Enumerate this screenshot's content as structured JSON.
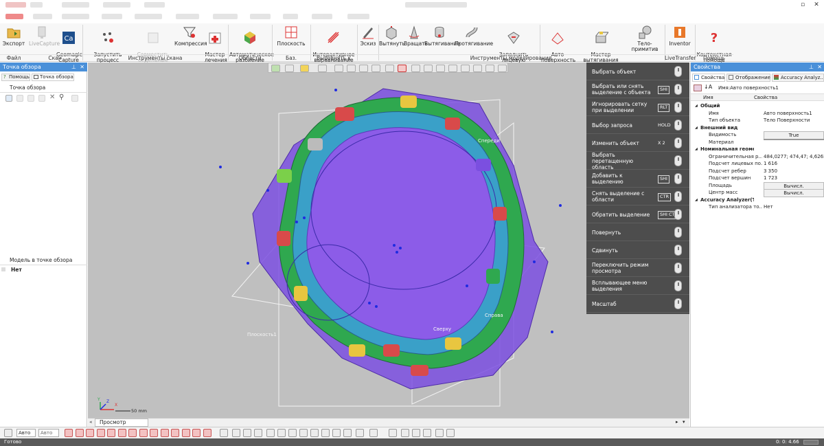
{
  "colors": {
    "accent": "#4a90d9",
    "menu_bg": "#4d4d4d",
    "mesh_purple": "#7b4fe0",
    "mesh_green": "#2fa84f",
    "material_swatch": "#e8e07a"
  },
  "window": {
    "restore_icon": "restore-icon",
    "close_icon": "close-icon"
  },
  "ribbon": {
    "buttons": [
      {
        "label": "Экспорт",
        "icon": "folder-icon",
        "disabled": false
      },
      {
        "label": "LiveCapture",
        "icon": "livecapture-icon",
        "disabled": true
      },
      {
        "label": "Geomagic\nCapture",
        "icon": "capture-icon",
        "disabled": false
      },
      {
        "label": "Запустить процесс\nсканирования",
        "icon": "scan-process-icon",
        "disabled": false
      },
      {
        "label": "Совместить\nотдельные сканы",
        "icon": "align-scans-icon",
        "disabled": true
      },
      {
        "label": "Компрессия",
        "icon": "compress-icon",
        "disabled": false
      },
      {
        "label": "Мастер\nлечения",
        "icon": "healing-icon",
        "disabled": false
      },
      {
        "label": "Автоматическое\nразбиение",
        "icon": "auto-segment-icon",
        "disabled": false
      },
      {
        "label": "Плоскость",
        "icon": "plane-icon",
        "disabled": false
      },
      {
        "label": "Интерактивное\nвыравнивание",
        "icon": "interactive-align-icon",
        "disabled": false
      },
      {
        "label": "Эскиз",
        "icon": "sketch-icon",
        "disabled": false
      },
      {
        "label": "Вытянуть",
        "icon": "extrude-icon",
        "disabled": false
      },
      {
        "label": "Вращать",
        "icon": "revolve-icon",
        "disabled": false
      },
      {
        "label": "Вытягивание",
        "icon": "sweep-icon",
        "disabled": false
      },
      {
        "label": "Протягивание",
        "icon": "loft-icon",
        "disabled": false
      },
      {
        "label": "Заполнить лицевую\nповерхность",
        "icon": "fill-face-icon",
        "disabled": false
      },
      {
        "label": "Авто\nповерхность",
        "icon": "auto-surface-icon",
        "disabled": false
      },
      {
        "label": "Мастер вытягивания\nпо сечениям",
        "icon": "mesh-fit-icon",
        "disabled": false
      },
      {
        "label": "Тело-примитив",
        "icon": "primitive-icon",
        "disabled": false
      },
      {
        "label": "Inventor",
        "icon": "inventor-icon",
        "disabled": false
      },
      {
        "label": "Контекстная\nпомощь",
        "icon": "help-icon",
        "disabled": false
      }
    ],
    "groups": [
      "Файл",
      "Скан",
      "Инструменты скана",
      "Области",
      "Баз. геометрия",
      "Выровнять к миру",
      "Инструменты моделирования",
      "LiveTransfer",
      "Помощь"
    ]
  },
  "left_panel": {
    "header": "Точка обзора",
    "tabs": [
      "Помощь",
      "Точка обзора"
    ],
    "section_title": "Точка обзора",
    "model_label": "Модель в точке обзора",
    "model_value": "Нет"
  },
  "viewport": {
    "labels": {
      "front": "Спереди",
      "right": "Справа",
      "top": "Сверху",
      "plane": "Плоскость1"
    },
    "scale_text": "50 mm",
    "axes": {
      "x": "X",
      "y": "Y",
      "z": "Z"
    }
  },
  "mouse_menu": [
    {
      "label": "Выбрать объект",
      "key": ""
    },
    {
      "label": "Выбрать или снять выделение с объекта",
      "key": "SHI"
    },
    {
      "label": "Игнорировать сетку при выделении",
      "key": "RLT"
    },
    {
      "label": "Выбор запроса",
      "key": "HOLD"
    },
    {
      "label": "Изменить объект",
      "key": "X 2"
    },
    {
      "label": "Выбрать перетащенную область",
      "key": ""
    },
    {
      "label": "Добавить к выделению",
      "key": "SHI"
    },
    {
      "label": "Снять выделение с области",
      "key": "CTR"
    },
    {
      "label": "Обратить выделение",
      "key": "SHI CTR"
    },
    {
      "label": "Повернуть",
      "key": ""
    },
    {
      "label": "Сдвинуть",
      "key": ""
    },
    {
      "label": "Переключить режим просмотра",
      "key": ""
    },
    {
      "label": "Всплывающее меню выделения",
      "key": ""
    },
    {
      "label": "Масштаб",
      "key": ""
    }
  ],
  "right_panel": {
    "header": "Свойства",
    "tabs": [
      "Свойства",
      "Отображение",
      "Accuracy Analyz..."
    ],
    "name_field": "Имя:Авто поверхность1",
    "col_name": "Имя",
    "col_props": "Свойства",
    "rows": [
      {
        "k": "Общий",
        "v": "",
        "cat": true
      },
      {
        "k": "Имя",
        "v": "Авто поверхность1"
      },
      {
        "k": "Тип объекта",
        "v": "Тело Поверхности"
      },
      {
        "k": "Внешний вид",
        "v": "",
        "cat": true
      },
      {
        "k": "Видимость",
        "v": "True"
      },
      {
        "k": "Материал",
        "v": ""
      },
      {
        "k": "Номинальная геометрия",
        "v": "",
        "cat": true
      },
      {
        "k": "Ограничительная р...",
        "v": "484,0277; 474,47; 4,6265"
      },
      {
        "k": "Подсчет лицевых по...",
        "v": "1 616"
      },
      {
        "k": "Подсчет ребер",
        "v": "3 350"
      },
      {
        "k": "Подсчет вершин",
        "v": "1 723"
      },
      {
        "k": "Площадь",
        "v": "Вычисл."
      },
      {
        "k": "Центр масс",
        "v": "Вычисл."
      },
      {
        "k": "Accuracy Analyzer(TM)",
        "v": "",
        "cat": true
      },
      {
        "k": "Тип анализатора то...",
        "v": "Нет"
      }
    ]
  },
  "bottom": {
    "tab": "Просмотр модели",
    "combo1": "Авто",
    "combo2": "Авто"
  },
  "status": {
    "left": "Готово",
    "right": "0: 0: 4.66"
  }
}
